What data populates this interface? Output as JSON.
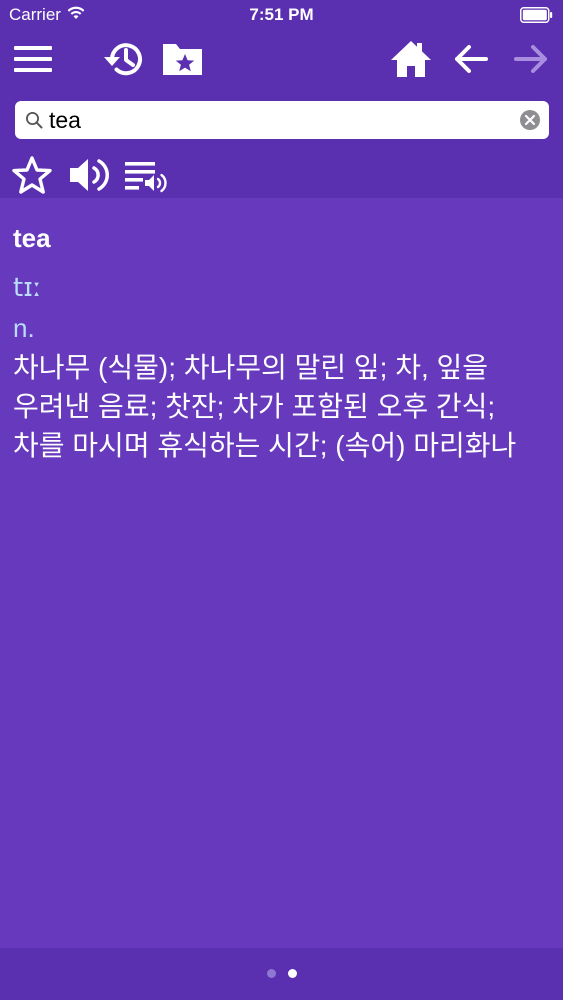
{
  "status_bar": {
    "carrier": "Carrier",
    "time": "7:51 PM"
  },
  "toolbar": {
    "icons": [
      "menu-icon",
      "history-icon",
      "bookmark-folder-icon",
      "home-icon",
      "back-arrow-icon",
      "forward-arrow-icon"
    ],
    "forward_enabled": false
  },
  "search": {
    "value": "tea",
    "placeholder": ""
  },
  "actions": {
    "icons": [
      "star-icon",
      "speaker-icon",
      "speak-list-icon"
    ]
  },
  "entry": {
    "word": "tea",
    "pronunciation": "tɪː",
    "part_of_speech": "n.",
    "definition": "차나무 (식물); 차나무의 말린 잎; 차, 잎을 우려낸 음료; 찻잔; 차가 포함된 오후 간식; 차를 마시며 휴식하는 시간; (속어) 마리화나"
  },
  "pager": {
    "page_count": 2,
    "current_page": 2
  },
  "colors": {
    "background": "#6739bc",
    "header": "#5a2fb0",
    "pronunciation_text": "#b9dcff",
    "disabled_icon": "#a98ee0"
  }
}
